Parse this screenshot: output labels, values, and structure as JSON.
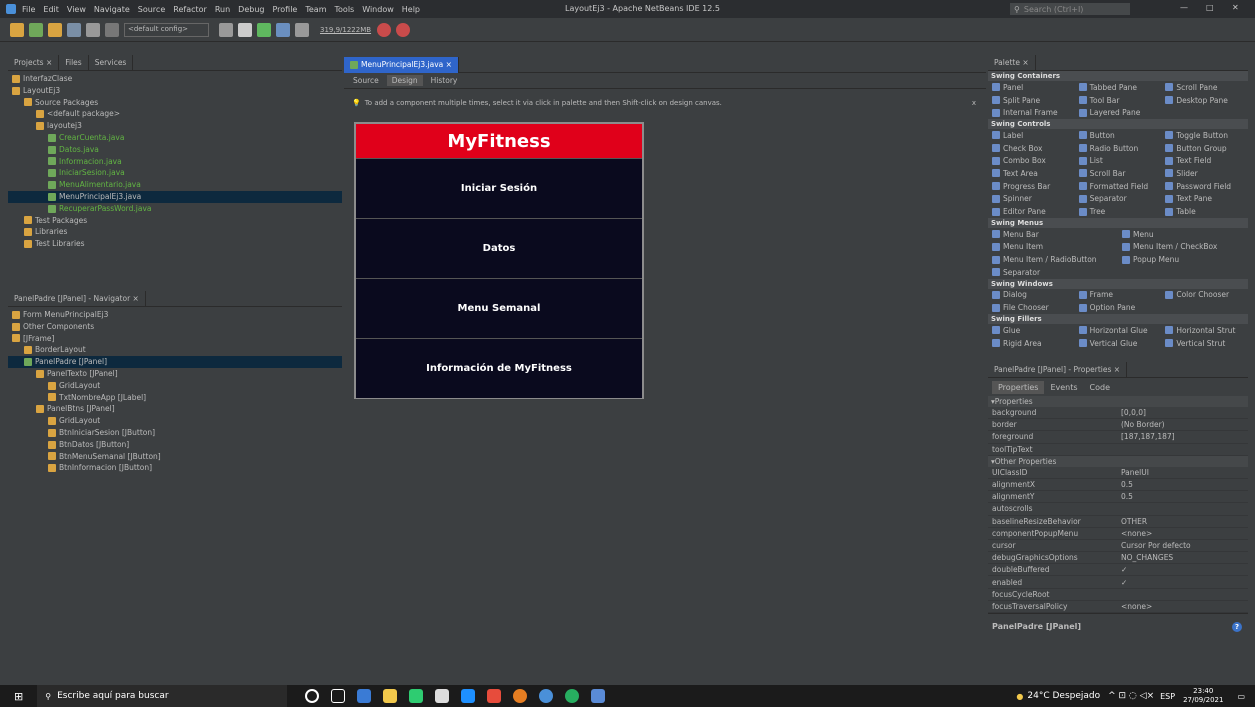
{
  "window": {
    "menu": [
      "File",
      "Edit",
      "View",
      "Navigate",
      "Source",
      "Refactor",
      "Run",
      "Debug",
      "Profile",
      "Team",
      "Tools",
      "Window",
      "Help"
    ],
    "title": "LayoutEj3 - Apache NetBeans IDE 12.5",
    "search_placeholder": "Search (Ctrl+I)"
  },
  "toolbar": {
    "config": "<default config>",
    "memory": "319,9/1222MB"
  },
  "projects": {
    "tabs": [
      "Projects ×",
      "Files",
      "Services"
    ],
    "tree": [
      {
        "label": "InterfazClase",
        "indent": 0,
        "style": ""
      },
      {
        "label": "LayoutEj3",
        "indent": 0,
        "style": ""
      },
      {
        "label": "Source Packages",
        "indent": 1,
        "style": ""
      },
      {
        "label": "<default package>",
        "indent": 2,
        "style": ""
      },
      {
        "label": "layoutej3",
        "indent": 2,
        "style": ""
      },
      {
        "label": "CrearCuenta.java",
        "indent": 3,
        "style": "green"
      },
      {
        "label": "Datos.java",
        "indent": 3,
        "style": "green"
      },
      {
        "label": "Informacion.java",
        "indent": 3,
        "style": "green"
      },
      {
        "label": "IniciarSesion.java",
        "indent": 3,
        "style": "green"
      },
      {
        "label": "MenuAlimentario.java",
        "indent": 3,
        "style": "green"
      },
      {
        "label": "MenuPrincipalEj3.java",
        "indent": 3,
        "style": "sel"
      },
      {
        "label": "RecuperarPassWord.java",
        "indent": 3,
        "style": "green"
      },
      {
        "label": "Test Packages",
        "indent": 1,
        "style": ""
      },
      {
        "label": "Libraries",
        "indent": 1,
        "style": ""
      },
      {
        "label": "Test Libraries",
        "indent": 1,
        "style": ""
      }
    ]
  },
  "navigator": {
    "title": "PanelPadre [JPanel] - Navigator ×",
    "tree": [
      {
        "label": "Form MenuPrincipalEj3",
        "indent": 0,
        "style": ""
      },
      {
        "label": "Other Components",
        "indent": 0,
        "style": ""
      },
      {
        "label": "[JFrame]",
        "indent": 0,
        "style": ""
      },
      {
        "label": "BorderLayout",
        "indent": 1,
        "style": ""
      },
      {
        "label": "PanelPadre [JPanel]",
        "indent": 1,
        "style": "sel"
      },
      {
        "label": "PanelTexto [JPanel]",
        "indent": 2,
        "style": ""
      },
      {
        "label": "GridLayout",
        "indent": 3,
        "style": ""
      },
      {
        "label": "TxtNombreApp [JLabel]",
        "indent": 3,
        "style": ""
      },
      {
        "label": "PanelBtns [JPanel]",
        "indent": 2,
        "style": ""
      },
      {
        "label": "GridLayout",
        "indent": 3,
        "style": ""
      },
      {
        "label": "BtnIniciarSesion [JButton]",
        "indent": 3,
        "style": ""
      },
      {
        "label": "BtnDatos [JButton]",
        "indent": 3,
        "style": ""
      },
      {
        "label": "BtnMenuSemanal [JButton]",
        "indent": 3,
        "style": ""
      },
      {
        "label": "BtnInformacion [JButton]",
        "indent": 3,
        "style": ""
      }
    ]
  },
  "editor": {
    "tab": "MenuPrincipalEj3.java ×",
    "modes": [
      "Source",
      "Design",
      "History"
    ],
    "hint": "To add a component multiple times, select it via click in palette and then Shift-click on design canvas.",
    "form": {
      "app_title": "MyFitness",
      "buttons": [
        "Iniciar Sesión",
        "Datos",
        "Menu Semanal",
        "Información de MyFitness"
      ]
    }
  },
  "palette": {
    "title": "Palette ×",
    "sections": [
      {
        "name": "Swing Containers",
        "rows": [
          [
            "Panel",
            "Tabbed Pane",
            "Scroll Pane"
          ],
          [
            "Split Pane",
            "Tool Bar",
            "Desktop Pane"
          ],
          [
            "Internal Frame",
            "Layered Pane",
            ""
          ]
        ]
      },
      {
        "name": "Swing Controls",
        "rows": [
          [
            "Label",
            "Button",
            "Toggle Button"
          ],
          [
            "Check Box",
            "Radio Button",
            "Button Group"
          ],
          [
            "Combo Box",
            "List",
            "Text Field"
          ],
          [
            "Text Area",
            "Scroll Bar",
            "Slider"
          ],
          [
            "Progress Bar",
            "Formatted Field",
            "Password Field"
          ],
          [
            "Spinner",
            "Separator",
            "Text Pane"
          ],
          [
            "Editor Pane",
            "Tree",
            "Table"
          ]
        ]
      },
      {
        "name": "Swing Menus",
        "rows": [
          [
            "Menu Bar",
            "Menu"
          ],
          [
            "Menu Item",
            "Menu Item / CheckBox"
          ],
          [
            "Menu Item / RadioButton",
            "Popup Menu"
          ],
          [
            "Separator",
            ""
          ]
        ]
      },
      {
        "name": "Swing Windows",
        "rows": [
          [
            "Dialog",
            "Frame",
            "Color Chooser"
          ],
          [
            "File Chooser",
            "Option Pane",
            ""
          ]
        ]
      },
      {
        "name": "Swing Fillers",
        "rows": [
          [
            "Glue",
            "Horizontal Glue",
            "Horizontal Strut"
          ],
          [
            "Rigid Area",
            "Vertical Glue",
            "Vertical Strut"
          ]
        ]
      }
    ]
  },
  "properties": {
    "title": "PanelPadre [JPanel] - Properties ×",
    "tabs": [
      "Properties",
      "Events",
      "Code"
    ],
    "sec1": "Properties",
    "rows1": [
      [
        "background",
        "[0,0,0]"
      ],
      [
        "border",
        "(No Border)"
      ],
      [
        "foreground",
        "[187,187,187]"
      ],
      [
        "toolTipText",
        ""
      ]
    ],
    "sec2": "Other Properties",
    "rows2": [
      [
        "UIClassID",
        "PanelUI"
      ],
      [
        "alignmentX",
        "0.5"
      ],
      [
        "alignmentY",
        "0.5"
      ],
      [
        "autoscrolls",
        ""
      ],
      [
        "baselineResizeBehavior",
        "OTHER"
      ],
      [
        "componentPopupMenu",
        "<none>"
      ],
      [
        "cursor",
        "Cursor Por defecto"
      ],
      [
        "debugGraphicsOptions",
        "NO_CHANGES"
      ],
      [
        "doubleBuffered",
        "✓"
      ],
      [
        "enabled",
        "✓"
      ],
      [
        "focusCycleRoot",
        ""
      ],
      [
        "focusTraversalPolicy",
        "<none>"
      ]
    ],
    "footer": "PanelPadre [JPanel]"
  },
  "taskbar": {
    "search": "Escribe aquí para buscar",
    "weather": "24°C Despejado",
    "lang": "ESP",
    "time": "23:40",
    "date": "27/09/2021"
  }
}
